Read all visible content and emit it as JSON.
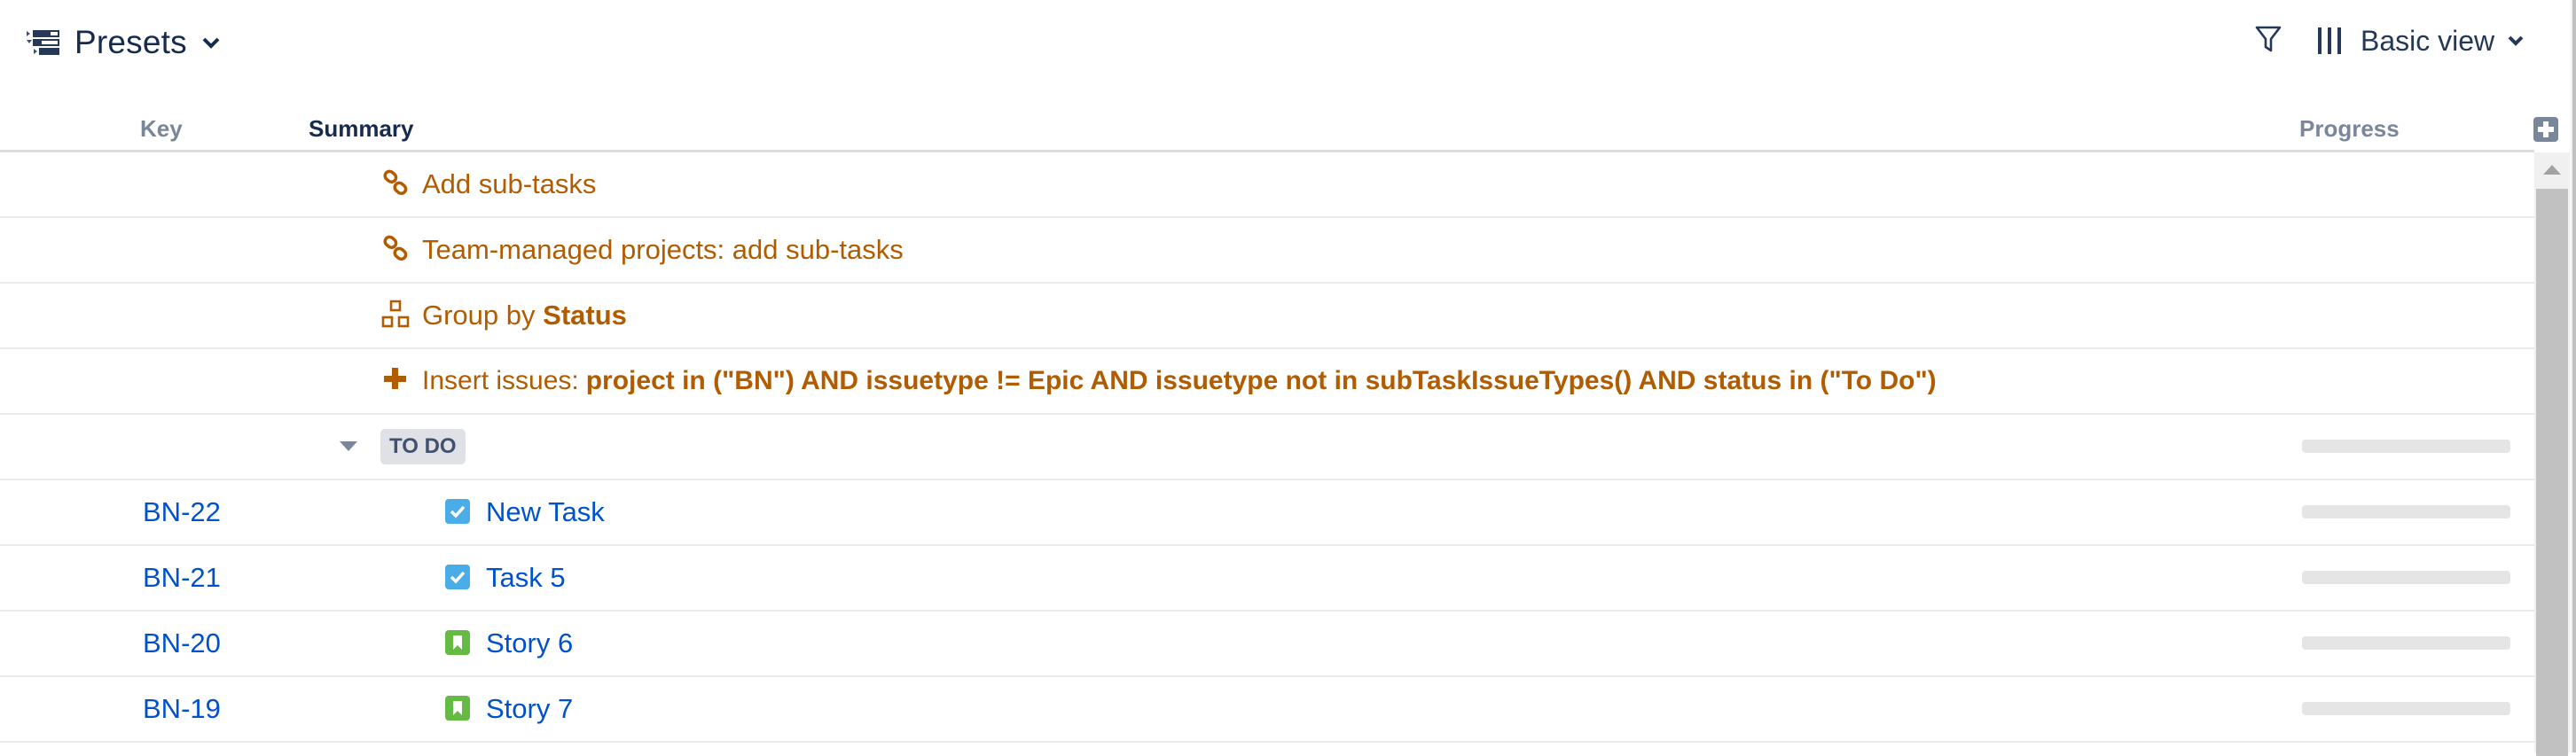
{
  "toolbar": {
    "presets_label": "Presets",
    "presets_icon": "structure-presets-icon",
    "filter_icon": "filter-icon",
    "view_icon": "columns-icon",
    "view_label": "Basic view"
  },
  "table": {
    "columns": [
      {
        "key": "key",
        "label": "Key"
      },
      {
        "key": "summary",
        "label": "Summary"
      },
      {
        "key": "progress",
        "label": "Progress"
      }
    ],
    "add_column_icon": "plus-square-icon",
    "generator_rows": [
      {
        "icon": "link-icon",
        "text": "Add sub-tasks"
      },
      {
        "icon": "link-icon",
        "text": "Team-managed projects: add sub-tasks"
      },
      {
        "icon": "group-icon",
        "prefix": "Group by ",
        "bold": "Status"
      },
      {
        "icon": "plus-icon",
        "prefix": "Insert issues:",
        "bold": "project in (\"BN\") AND issuetype != Epic AND issuetype not in subTaskIssueTypes() AND status in (\"To Do\")"
      }
    ],
    "group": {
      "label": "TO DO",
      "expanded": true,
      "progress": 0
    },
    "issues": [
      {
        "key": "BN-22",
        "type": "task",
        "summary": "New Task",
        "progress": 0
      },
      {
        "key": "BN-21",
        "type": "task",
        "summary": "Task 5",
        "progress": 0
      },
      {
        "key": "BN-20",
        "type": "story",
        "summary": "Story 6",
        "progress": 0
      },
      {
        "key": "BN-19",
        "type": "story",
        "summary": "Story 7",
        "progress": 0
      }
    ]
  },
  "colors": {
    "generator_text": "#b15c00",
    "link": "#0052cc",
    "header_muted": "#7a869a",
    "header_active": "#172b4d",
    "task": "#4bade8",
    "story": "#65ba43",
    "progress_track": "#e5e5e5"
  }
}
